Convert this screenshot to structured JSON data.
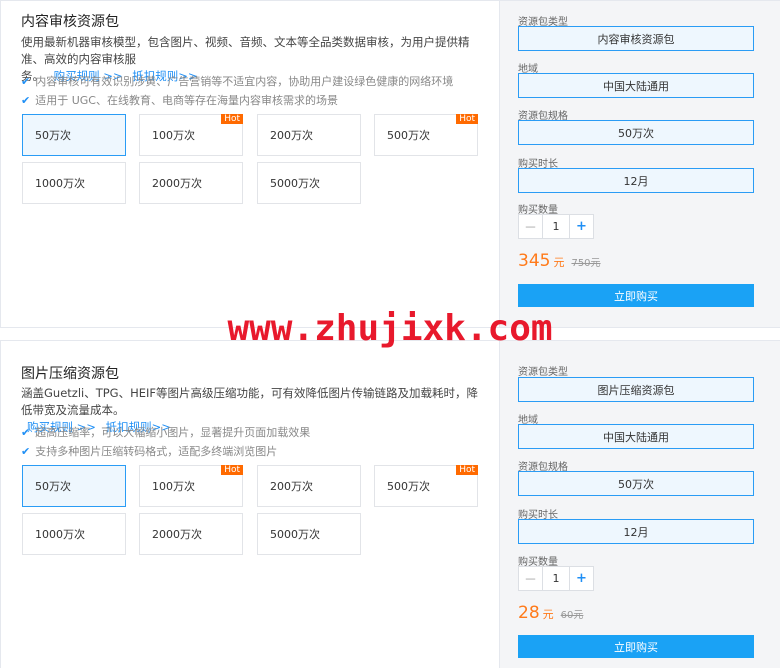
{
  "colors": {
    "accent": "#1f8ff5",
    "selected_bg": "#eef7fe",
    "price": "#ff7a1a",
    "buy_bg": "#1aa2f5",
    "hot_bg": "#ff6a00",
    "watermark": "#e8192c"
  },
  "watermark_text": "www.zhujixk.com",
  "packages": [
    {
      "title": "内容审核资源包",
      "desc_line1": "使用最新机器审核模型，包含图片、视频、音频、文本等全品类数据审核，为用户提供精准、高效的内容审核服",
      "desc_line2": "务。",
      "link_rules": "购买规则 >>",
      "link_deduct": "抵扣规则>>",
      "features": [
        "内容审核可有效识别涉黄、广告营销等不适宜内容，协助用户建设绿色健康的网络环境",
        "适用于 UGC、在线教育、电商等存在海量内容审核需求的场景"
      ],
      "options": [
        "50万次",
        "100万次",
        "200万次",
        "500万次",
        "1000万次",
        "2000万次",
        "5000万次"
      ],
      "hot_label": "Hot",
      "form": {
        "type_label": "资源包类型",
        "type_value": "内容审核资源包",
        "region_label": "地域",
        "region_value": "中国大陆通用",
        "spec_label": "资源包规格",
        "spec_value": "50万次",
        "duration_label": "购买时长",
        "duration_value": "12月",
        "qty_label": "购买数量",
        "qty_minus": "－",
        "qty_value": "1",
        "qty_plus": "+"
      },
      "price": "345",
      "price_unit": "元",
      "old_price": "750元",
      "buy_label": "立即购买"
    },
    {
      "title": "图片压缩资源包",
      "desc_line1": "涵盖Guetzli、TPG、HEIF等图片高级压缩功能，可有效降低图片传输链路及加载耗时，降低带宽及流量成本。",
      "desc_line2": "",
      "link_rules": "购买规则 >>",
      "link_deduct": "抵扣规则>>",
      "features": [
        "超高压缩率，可以大幅缩小图片，显著提升页面加载效果",
        "支持多种图片压缩转码格式，适配多终端浏览图片"
      ],
      "options": [
        "50万次",
        "100万次",
        "200万次",
        "500万次",
        "1000万次",
        "2000万次",
        "5000万次"
      ],
      "hot_label": "Hot",
      "form": {
        "type_label": "资源包类型",
        "type_value": "图片压缩资源包",
        "region_label": "地域",
        "region_value": "中国大陆通用",
        "spec_label": "资源包规格",
        "spec_value": "50万次",
        "duration_label": "购买时长",
        "duration_value": "12月",
        "qty_label": "购买数量",
        "qty_minus": "－",
        "qty_value": "1",
        "qty_plus": "+"
      },
      "price": "28",
      "price_unit": "元",
      "old_price": "60元",
      "buy_label": "立即购买"
    }
  ]
}
